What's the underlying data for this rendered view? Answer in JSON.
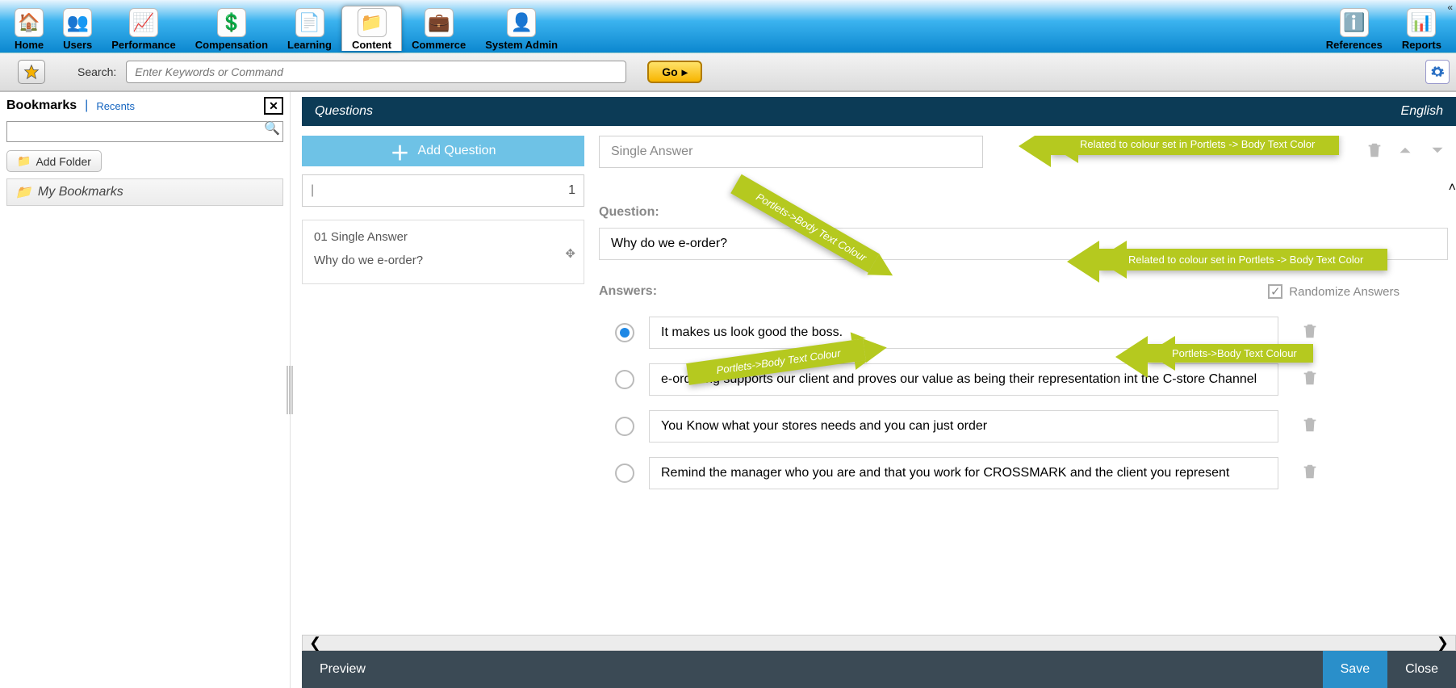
{
  "nav": {
    "items": [
      {
        "label": "Home",
        "icon": "🏠"
      },
      {
        "label": "Users",
        "icon": "👥"
      },
      {
        "label": "Performance",
        "icon": "📈"
      },
      {
        "label": "Compensation",
        "icon": "💲"
      },
      {
        "label": "Learning",
        "icon": "📄"
      },
      {
        "label": "Content",
        "icon": "📁",
        "active": true
      },
      {
        "label": "Commerce",
        "icon": "💼"
      },
      {
        "label": "System Admin",
        "icon": "👤"
      }
    ],
    "right": [
      {
        "label": "References",
        "icon": "ℹ️"
      },
      {
        "label": "Reports",
        "icon": "📊"
      }
    ]
  },
  "search": {
    "label": "Search:",
    "placeholder": "Enter Keywords or Command",
    "go": "Go"
  },
  "sidebar": {
    "title": "Bookmarks",
    "recents": "Recents",
    "addFolder": "Add Folder",
    "rootFolder": "My Bookmarks"
  },
  "editor": {
    "panelTitle": "Questions",
    "language": "English",
    "addQuestion": "Add Question",
    "page": {
      "number": "1"
    },
    "selected": {
      "type": "01 Single Answer",
      "text": "Why do we e-order?"
    },
    "typeSelector": "Single Answer",
    "questionLabel": "Question:",
    "questionText": "Why do we e-order?",
    "answersLabel": "Answers:",
    "randomize": "Randomize Answers",
    "answers": [
      {
        "text": "It makes us look good the boss.",
        "selected": true
      },
      {
        "text": "e-ordering supports our client and proves our value as being their representation int the C-store Channel",
        "selected": false
      },
      {
        "text": "You Know what your stores needs and you can just order",
        "selected": false
      },
      {
        "text": "Remind the manager who you are and that you work for CROSSMARK and the client you represent",
        "selected": false
      }
    ]
  },
  "footer": {
    "preview": "Preview",
    "save": "Save",
    "close": "Close"
  },
  "annotations": {
    "a1": "Related to colour set in Portlets -> Body Text Color",
    "a2": "Portlets->Body Text Colour",
    "a3": "Related to colour set in Portlets -> Body Text Color",
    "a4": "Portlets->Body Text Colour",
    "a5": "Portlets->Body Text Colour"
  }
}
